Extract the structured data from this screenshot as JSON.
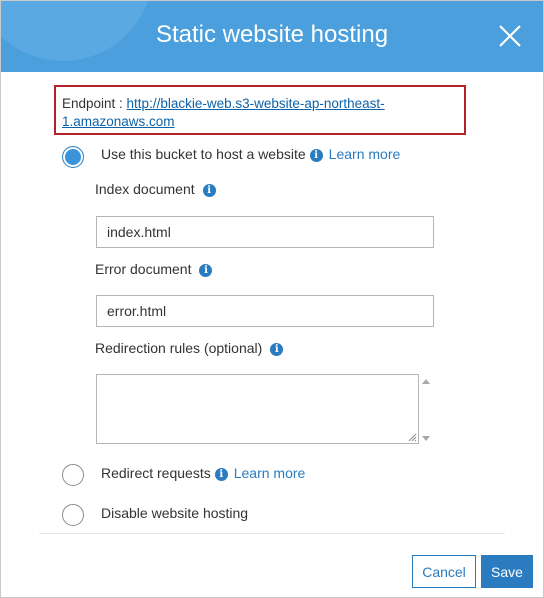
{
  "dialog": {
    "title": "Static website hosting"
  },
  "endpoint": {
    "label": "Endpoint : ",
    "url": "http://blackie-web.s3-website-ap-northeast-1.amazonaws.com"
  },
  "options": {
    "host": {
      "label": "Use this bucket to host a website",
      "learn_more": "Learn more",
      "selected": true
    },
    "redirect": {
      "label": "Redirect requests",
      "learn_more": "Learn more",
      "selected": false
    },
    "disable": {
      "label": "Disable website hosting",
      "selected": false
    }
  },
  "fields": {
    "index_document": {
      "label": "Index document",
      "value": "index.html"
    },
    "error_document": {
      "label": "Error document",
      "value": "error.html"
    },
    "redirection_rules": {
      "label": "Redirection rules (optional)",
      "value": ""
    }
  },
  "footer": {
    "cancel_label": "Cancel",
    "save_label": "Save"
  },
  "icons": {
    "close": "close-icon",
    "info": "info-icon",
    "globe": "globe-icon"
  },
  "colors": {
    "header_bg": "#4a9fdc",
    "accent": "#2a7bc0",
    "highlight_border": "#b3202a",
    "link": "#0d62a8"
  }
}
